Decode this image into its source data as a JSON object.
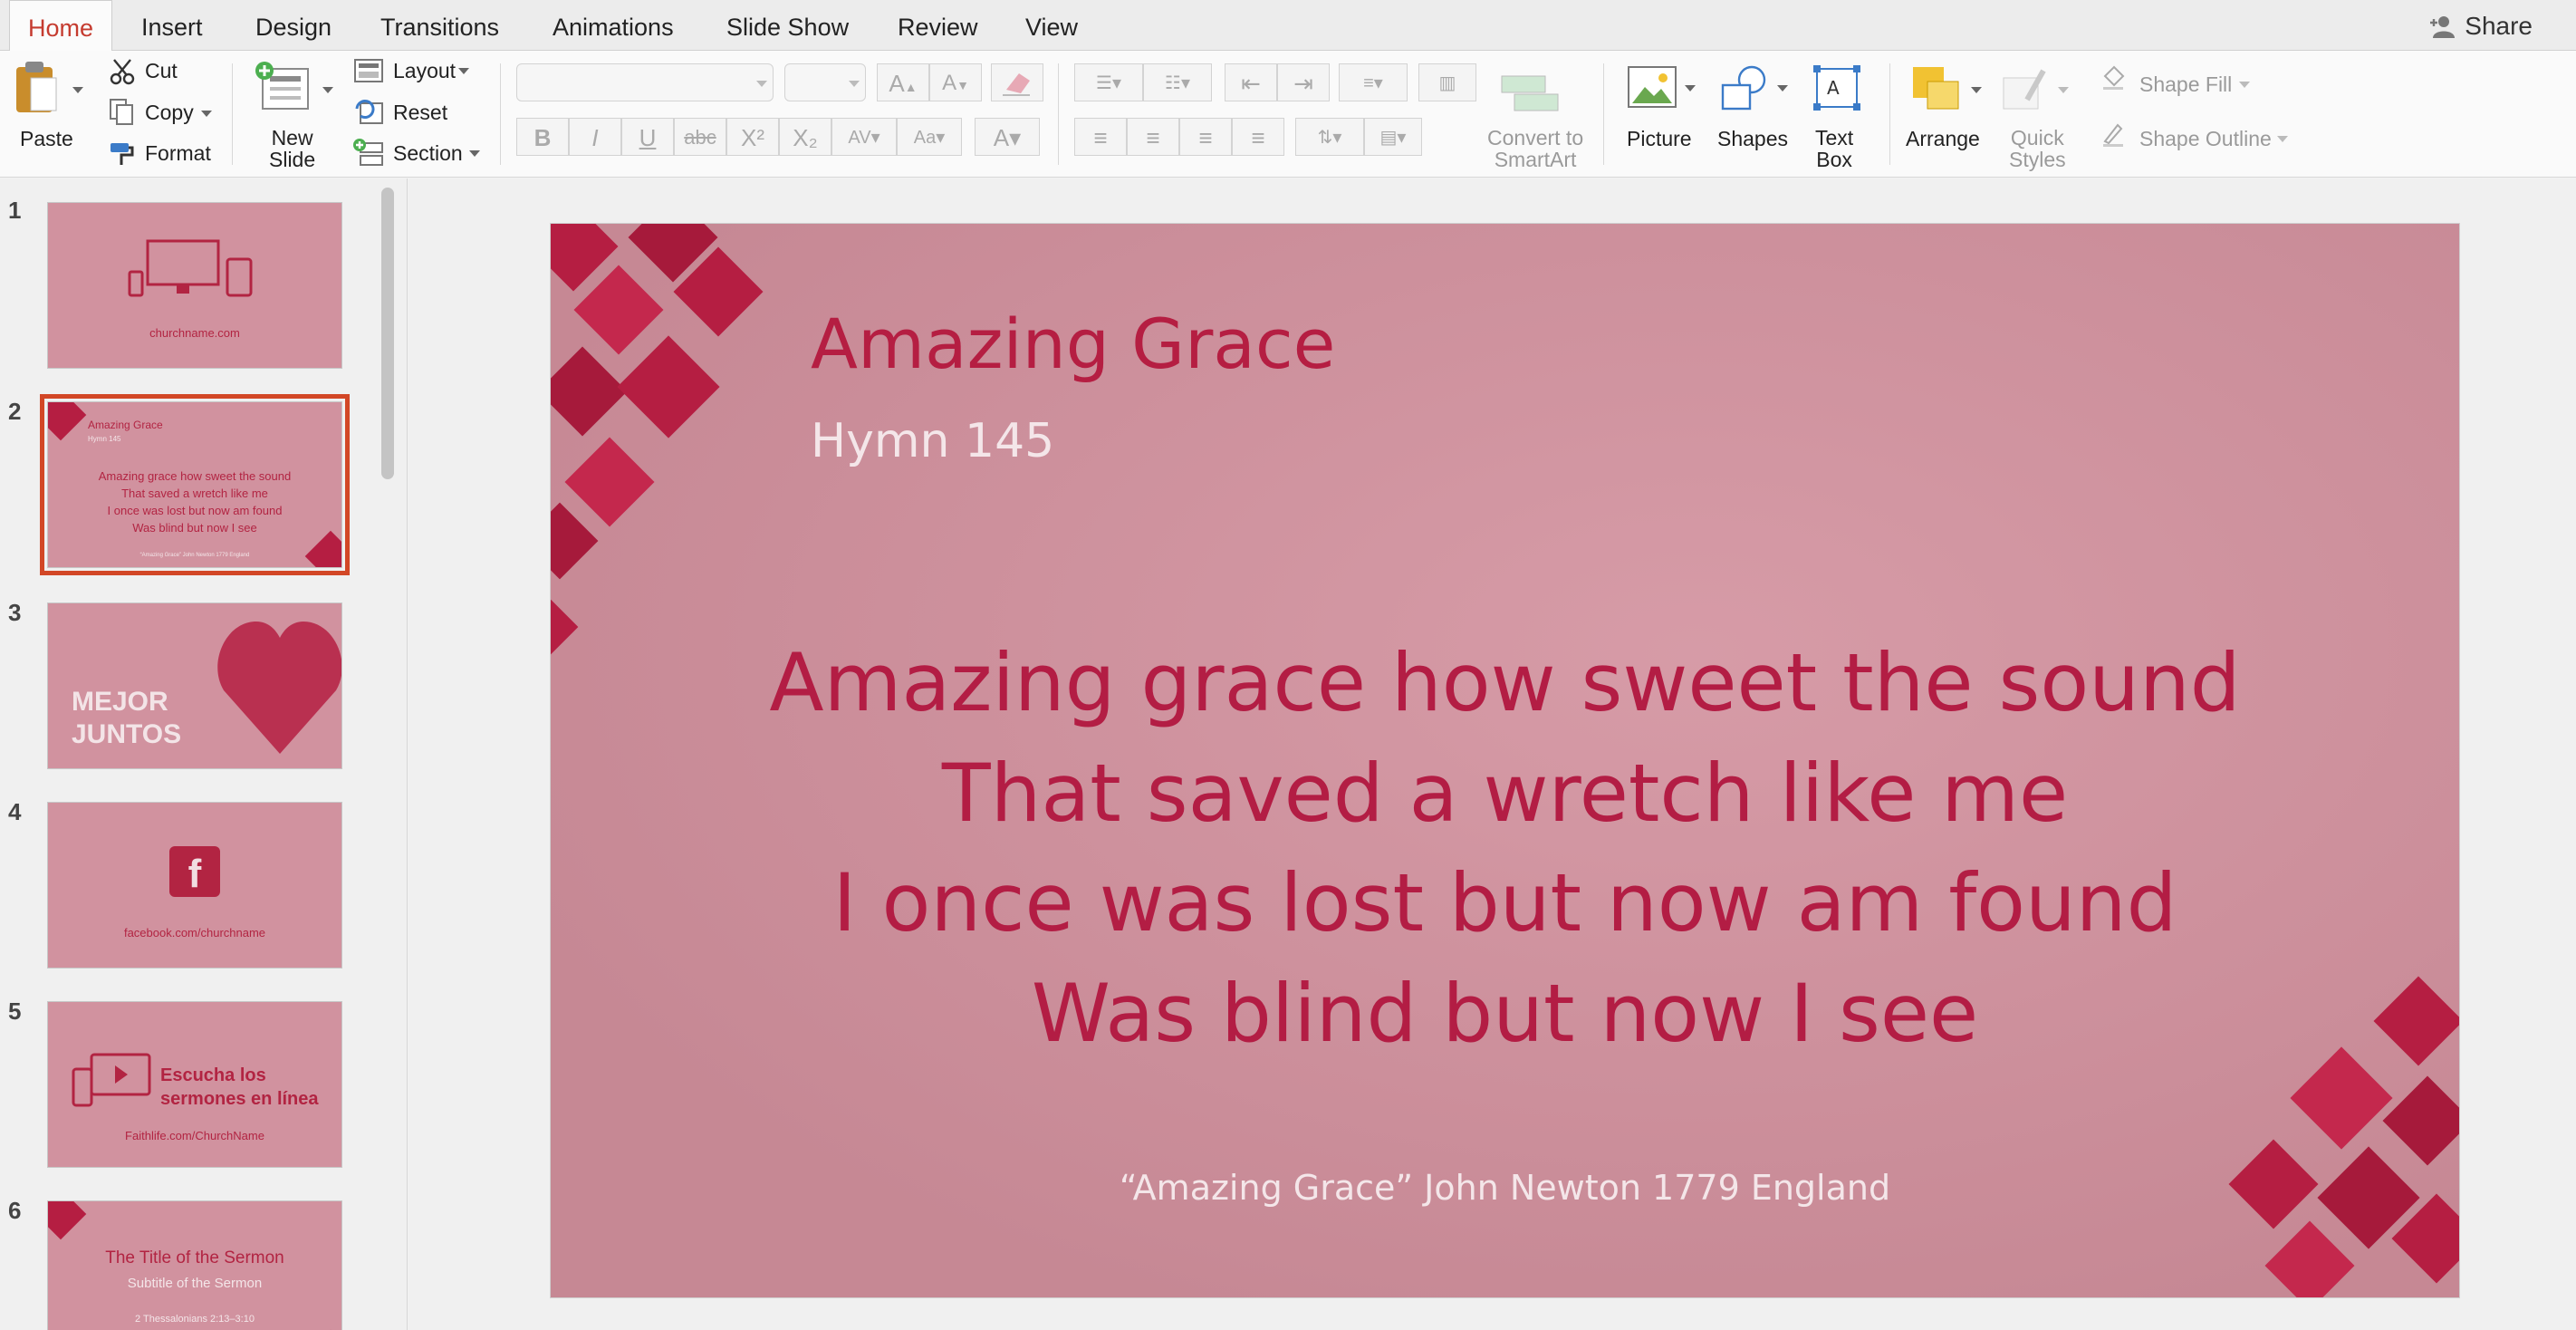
{
  "tabs": [
    {
      "label": "Home",
      "active": true
    },
    {
      "label": "Insert"
    },
    {
      "label": "Design"
    },
    {
      "label": "Transitions"
    },
    {
      "label": "Animations"
    },
    {
      "label": "Slide Show"
    },
    {
      "label": "Review"
    },
    {
      "label": "View"
    }
  ],
  "share_label": "Share",
  "ribbon": {
    "paste": "Paste",
    "cut": "Cut",
    "copy": "Copy",
    "format": "Format",
    "new_slide_1": "New",
    "new_slide_2": "Slide",
    "layout": "Layout",
    "reset": "Reset",
    "section": "Section",
    "bold": "B",
    "italic": "I",
    "underline": "U",
    "strike": "abc",
    "superscript": "X²",
    "subscript": "X₂",
    "convert_1": "Convert to",
    "convert_2": "SmartArt",
    "picture": "Picture",
    "shapes": "Shapes",
    "textbox_1": "Text",
    "textbox_2": "Box",
    "arrange": "Arrange",
    "quick_styles_1": "Quick",
    "quick_styles_2": "Styles",
    "shape_fill": "Shape Fill",
    "shape_outline": "Shape Outline"
  },
  "thumbnails": [
    {
      "num": "1",
      "text": "churchname.com"
    },
    {
      "num": "2",
      "title": "Amazing Grace",
      "sub": "Hymn 145",
      "lines": [
        "Amazing grace how sweet the sound",
        "That saved a wretch like me",
        "I once was lost but now am found",
        "Was blind but now I see"
      ],
      "credit": "“Amazing Grace” John Newton 1779 England"
    },
    {
      "num": "3",
      "line1": "MEJOR",
      "line2": "JUNTOS"
    },
    {
      "num": "4",
      "icon_letter": "f",
      "text": "facebook.com/churchname"
    },
    {
      "num": "5",
      "line1": "Escucha los",
      "line2": "sermones en línea",
      "text": "Faithlife.com/ChurchName"
    },
    {
      "num": "6",
      "title": "The Title of the Sermon",
      "sub": "Subtitle of the Sermon",
      "ref": "2 Thessalonians 2:13–3:10"
    }
  ],
  "slide": {
    "title": "Amazing Grace",
    "subtitle": "Hymn 145",
    "lyrics": [
      "Amazing grace how sweet the sound",
      "That saved a wretch like me",
      "I once was lost but now am found",
      "Was blind but now I see"
    ],
    "credit": "“Amazing Grace” John Newton 1779 England"
  },
  "colors": {
    "accent": "#c53b2f",
    "slide_bg": "#d2909d",
    "lyric": "#b31d44",
    "selection": "#d24726"
  }
}
